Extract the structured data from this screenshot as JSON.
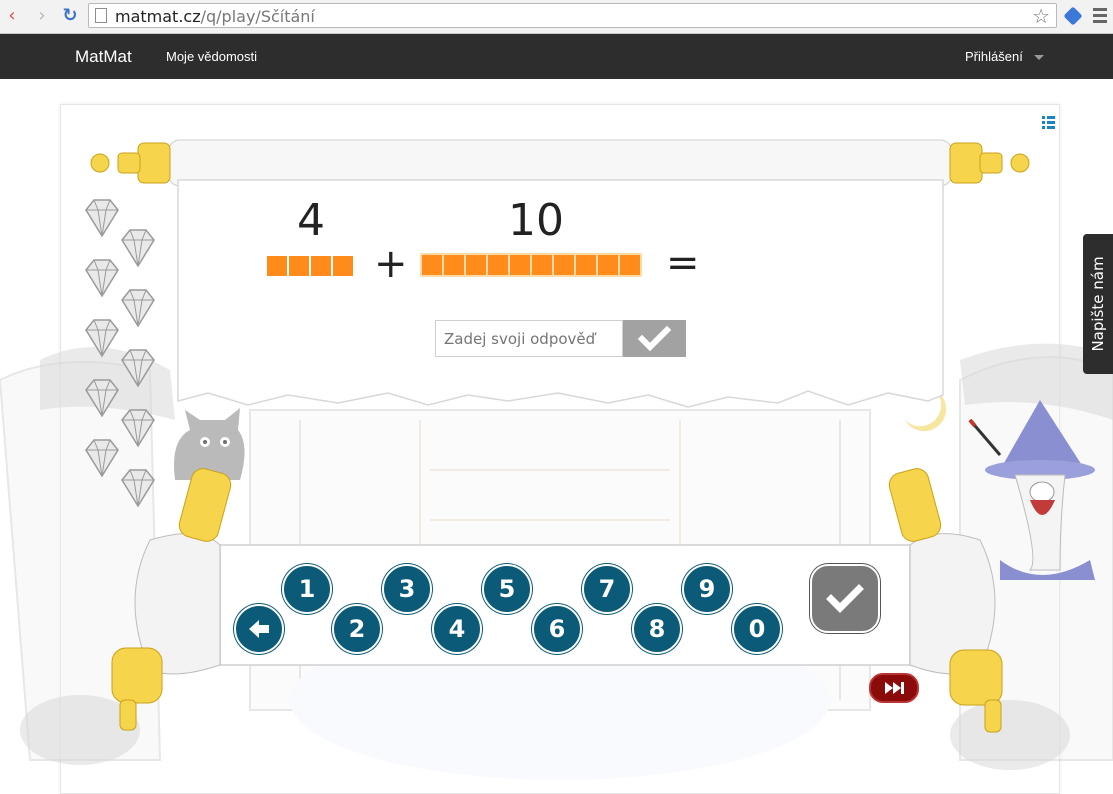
{
  "browser": {
    "url_host": "matmat.cz",
    "url_path": "/q/play/Sčítání"
  },
  "navbar": {
    "brand": "MatMat",
    "link": "Moje vědomosti",
    "login": "Přihlášení"
  },
  "problem": {
    "operand1": "4",
    "operand2": "10",
    "operator": "+",
    "equals": "=",
    "operand1_blocks": 4,
    "operand2_blocks": 10
  },
  "answer": {
    "placeholder": "Zadej svoji odpověď",
    "value": ""
  },
  "keypad": {
    "keys": [
      "1",
      "2",
      "3",
      "4",
      "5",
      "6",
      "7",
      "8",
      "9",
      "0"
    ]
  },
  "feedback": {
    "label": "Napište nám"
  },
  "colors": {
    "block": "#ff8c1a",
    "key": "#0b5a78",
    "navbar": "#2d2d2d",
    "skip": "#8b0a0a"
  },
  "icons": {
    "back": "back-arrow-icon",
    "forward": "forward-arrow-icon",
    "reload": "reload-icon",
    "star": "bookmark-star-icon",
    "list": "list-icon",
    "check": "check-icon",
    "backspace": "backspace-arrow-icon",
    "skip": "fast-forward-icon"
  }
}
